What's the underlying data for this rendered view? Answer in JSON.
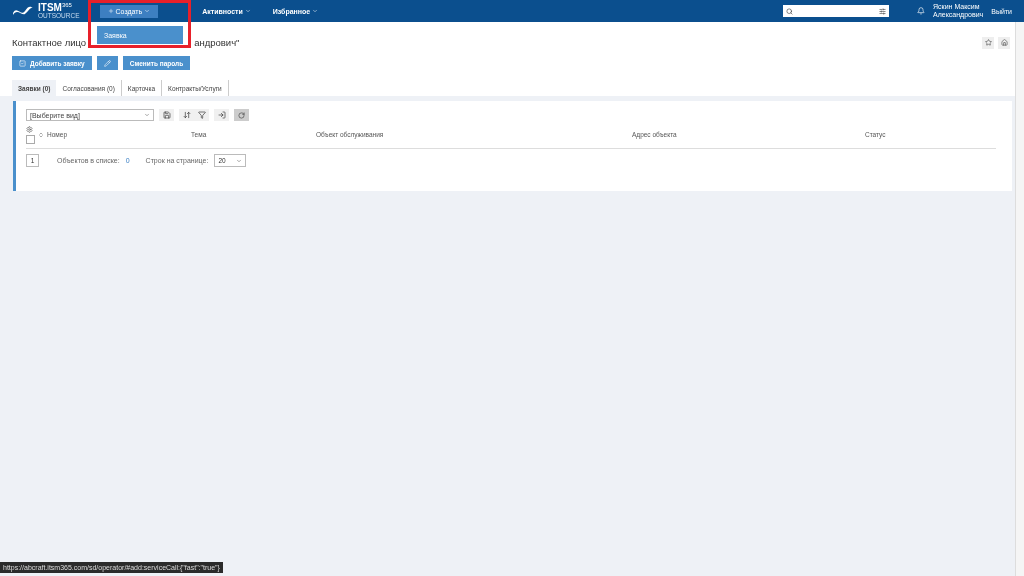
{
  "header": {
    "logo": {
      "name": "ITSM",
      "superscript": "365",
      "subtitle": "OUTSOURCE"
    },
    "menu": [
      {
        "label": "Создать",
        "kind": "primary"
      },
      {
        "label": "Активности",
        "kind": "plain"
      },
      {
        "label": "Избранное",
        "kind": "plain"
      }
    ],
    "user": {
      "name_line1": "Яскин Максим",
      "name_line2": "Александрович"
    },
    "logout": "Выйти"
  },
  "dropdown": {
    "items": [
      {
        "label": "Заявка",
        "selected": true
      }
    ]
  },
  "page": {
    "title_start": "Контактное лицо",
    "title_end": "андрович\"",
    "actions": [
      {
        "kind": "icon-text",
        "label": "Добавить заявку"
      },
      {
        "kind": "icon"
      },
      {
        "kind": "text",
        "label": "Сменить пароль"
      }
    ],
    "tabs": [
      {
        "label": "Заявки (0)",
        "selected": true
      },
      {
        "label": "Согласования (0)",
        "selected": false
      },
      {
        "label": "Карточка",
        "selected": false
      },
      {
        "label": "Контракты/Услуги",
        "selected": false
      }
    ]
  },
  "table": {
    "view_select": "[Выберите вид]",
    "columns": [
      "Номер",
      "Тема",
      "Объект обслуживания",
      "Адрес объекта",
      "Статус"
    ],
    "select_all_checked": false,
    "pager": {
      "page": "1",
      "count_label": "Объектов в списке:",
      "count": "0",
      "rows_label": "Строк на странице:",
      "rows": "20"
    }
  },
  "status_url": "https://abcraft.itsm365.com/sd/operator/#add:serviceCall:{\"fast\":\"true\"}"
}
